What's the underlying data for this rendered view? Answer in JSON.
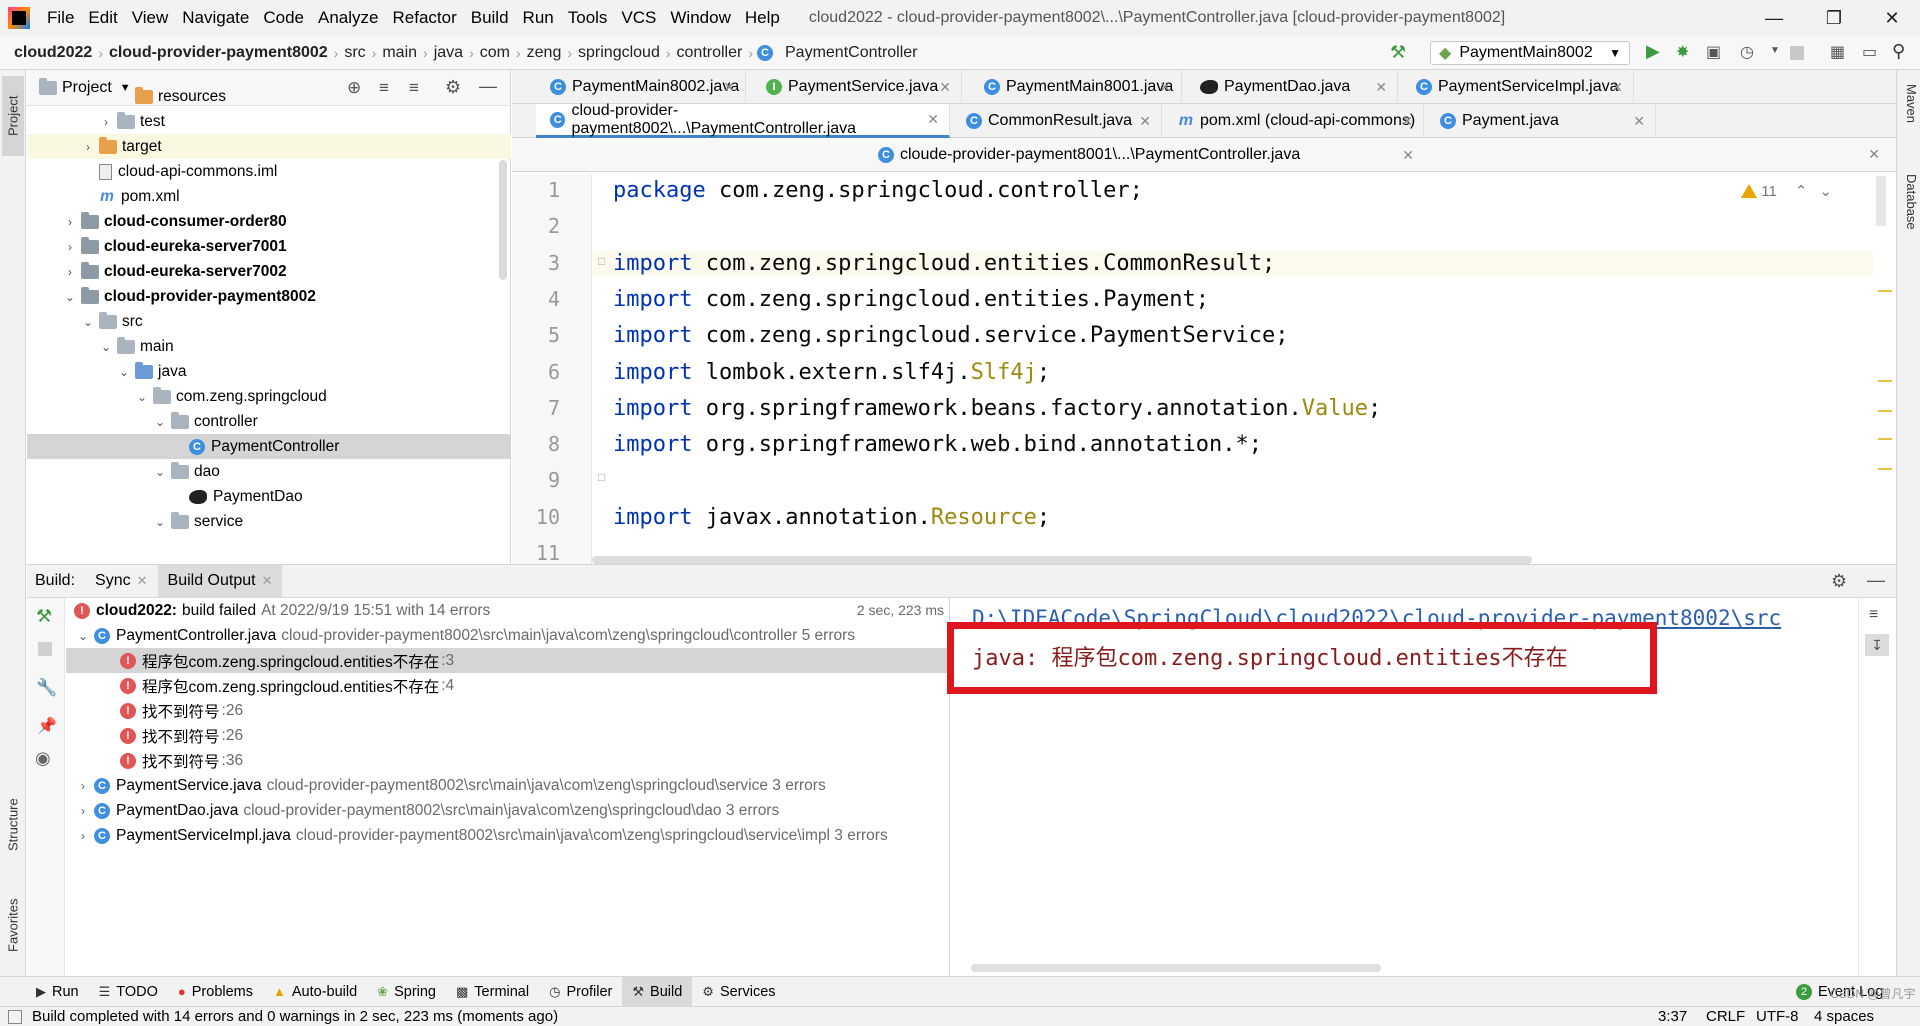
{
  "menu": [
    "File",
    "Edit",
    "View",
    "Navigate",
    "Code",
    "Analyze",
    "Refactor",
    "Build",
    "Run",
    "Tools",
    "VCS",
    "Window",
    "Help"
  ],
  "window_title": "cloud2022 - cloud-provider-payment8002\\...\\PaymentController.java [cloud-provider-payment8002]",
  "breadcrumbs": [
    "cloud2022",
    "cloud-provider-payment8002",
    "src",
    "main",
    "java",
    "com",
    "zeng",
    "springcloud",
    "controller",
    "PaymentController"
  ],
  "run_config": "PaymentMain8002",
  "project_panel": {
    "title": "Project",
    "tree": [
      {
        "label": "resources",
        "indent": 4,
        "icon": "folder-orange",
        "chevron": ""
      },
      {
        "label": "test",
        "indent": 3,
        "icon": "folder",
        "chevron": "›"
      },
      {
        "label": "target",
        "indent": 2,
        "icon": "folder-orange",
        "chevron": "›"
      },
      {
        "label": "cloud-api-commons.iml",
        "indent": 2,
        "icon": "iml",
        "chevron": ""
      },
      {
        "label": "pom.xml",
        "indent": 2,
        "icon": "m",
        "chevron": ""
      },
      {
        "label": "cloud-consumer-order80",
        "indent": 1,
        "icon": "module",
        "chevron": "›",
        "bold": true
      },
      {
        "label": "cloud-eureka-server7001",
        "indent": 1,
        "icon": "module",
        "chevron": "›",
        "bold": true
      },
      {
        "label": "cloud-eureka-server7002",
        "indent": 1,
        "icon": "module",
        "chevron": "›",
        "bold": true
      },
      {
        "label": "cloud-provider-payment8002",
        "indent": 1,
        "icon": "module",
        "chevron": "⌄",
        "bold": true
      },
      {
        "label": "src",
        "indent": 2,
        "icon": "folder",
        "chevron": "⌄"
      },
      {
        "label": "main",
        "indent": 3,
        "icon": "folder",
        "chevron": "⌄"
      },
      {
        "label": "java",
        "indent": 4,
        "icon": "folder-blue",
        "chevron": "⌄"
      },
      {
        "label": "com.zeng.springcloud",
        "indent": 5,
        "icon": "folder",
        "chevron": "⌄"
      },
      {
        "label": "controller",
        "indent": 6,
        "icon": "folder",
        "chevron": "⌄"
      },
      {
        "label": "PaymentController",
        "indent": 7,
        "icon": "class",
        "chevron": "",
        "selected": true
      },
      {
        "label": "dao",
        "indent": 6,
        "icon": "folder",
        "chevron": "⌄"
      },
      {
        "label": "PaymentDao",
        "indent": 7,
        "icon": "bird",
        "chevron": ""
      },
      {
        "label": "service",
        "indent": 6,
        "icon": "folder",
        "chevron": "⌄"
      }
    ]
  },
  "editor_tabs": {
    "row1": [
      {
        "label": "PaymentMain8002.java",
        "icon": "C"
      },
      {
        "label": "PaymentService.java",
        "icon": "I"
      },
      {
        "label": "PaymentMain8001.java",
        "icon": "C"
      },
      {
        "label": "PaymentDao.java",
        "icon": "bird"
      },
      {
        "label": "PaymentServiceImpl.java",
        "icon": "C"
      }
    ],
    "row2": [
      {
        "label": "cloud-provider-payment8002\\...\\PaymentController.java",
        "icon": "C",
        "active": true
      },
      {
        "label": "CommonResult.java",
        "icon": "C"
      },
      {
        "label": "pom.xml (cloud-api-commons)",
        "icon": "m"
      },
      {
        "label": "Payment.java",
        "icon": "C"
      }
    ],
    "row3": [
      {
        "label": "cloude-provider-payment8001\\...\\PaymentController.java",
        "icon": "C"
      }
    ]
  },
  "warnings_count": "11",
  "code_lines": [
    {
      "n": "1",
      "html": "<span class=\"kw\">package</span> com.zeng.springcloud.controller;"
    },
    {
      "n": "2",
      "html": ""
    },
    {
      "n": "3",
      "html": "<span class=\"kw\">import</span> com.zeng.springcloud.entities.CommonResult;"
    },
    {
      "n": "4",
      "html": "<span class=\"kw\">import</span> com.zeng.springcloud.entities.Payment;"
    },
    {
      "n": "5",
      "html": "<span class=\"kw\">import</span> com.zeng.springcloud.service.PaymentService;"
    },
    {
      "n": "6",
      "html": "<span class=\"kw\">import</span> lombok.extern.slf4j.<span class=\"ann\">Slf4j</span>;"
    },
    {
      "n": "7",
      "html": "<span class=\"kw\">import</span> org.springframework.beans.factory.annotation.<span class=\"ann\">Value</span>;"
    },
    {
      "n": "8",
      "html": "<span class=\"kw\">import</span> org.springframework.web.bind.annotation.*;"
    },
    {
      "n": "9",
      "html": ""
    },
    {
      "n": "10",
      "html": "<span class=\"kw\">import</span> javax.annotation.<span class=\"ann\">Resource</span>;"
    },
    {
      "n": "11",
      "html": ""
    }
  ],
  "build": {
    "tabs": {
      "label": "Build:",
      "sync": "Sync",
      "output": "Build Output"
    },
    "summary": {
      "project": "cloud2022:",
      "status": "build failed",
      "when": "At 2022/9/19 15:51 with 14 errors",
      "duration": "2 sec, 223 ms"
    },
    "rows": [
      {
        "file": "PaymentController.java",
        "path": "cloud-provider-payment8002\\src\\main\\java\\com\\zeng\\springcloud\\controller 5 errors",
        "expanded": true
      },
      {
        "msg": "程序包com.zeng.springcloud.entities不存在",
        "line": ":3",
        "selected": true
      },
      {
        "msg": "程序包com.zeng.springcloud.entities不存在",
        "line": ":4"
      },
      {
        "msg": "找不到符号",
        "line": ":26"
      },
      {
        "msg": "找不到符号",
        "line": ":26"
      },
      {
        "msg": "找不到符号",
        "line": ":36"
      },
      {
        "file": "PaymentService.java",
        "path": "cloud-provider-payment8002\\src\\main\\java\\com\\zeng\\springcloud\\service 3 errors"
      },
      {
        "file": "PaymentDao.java",
        "path": "cloud-provider-payment8002\\src\\main\\java\\com\\zeng\\springcloud\\dao 3 errors"
      },
      {
        "file": "PaymentServiceImpl.java",
        "path": "cloud-provider-payment8002\\src\\main\\java\\com\\zeng\\springcloud\\service\\impl 3 errors"
      }
    ],
    "console_path": "D:\\IDEACode\\SpringCloud\\cloud2022\\cloud-provider-payment8002\\src",
    "console_error": "java: 程序包com.zeng.springcloud.entities不存在",
    "highlight_color": "#e0161f"
  },
  "left_stripe": {
    "project": "Project",
    "structure": "Structure",
    "favorites": "Favorites"
  },
  "right_stripe": {
    "maven": "Maven",
    "database": "Database"
  },
  "bottom_tools": [
    {
      "label": "Run",
      "icon": "play"
    },
    {
      "label": "TODO",
      "icon": "list"
    },
    {
      "label": "Problems",
      "icon": "error"
    },
    {
      "label": "Auto-build",
      "icon": "warning"
    },
    {
      "label": "Spring",
      "icon": "leaf"
    },
    {
      "label": "Terminal",
      "icon": "terminal"
    },
    {
      "label": "Profiler",
      "icon": "gauge"
    },
    {
      "label": "Build",
      "icon": "hammer",
      "active": true
    },
    {
      "label": "Services",
      "icon": "services"
    }
  ],
  "event_log": {
    "count": "2",
    "label": "Event Log"
  },
  "status": {
    "message": "Build completed with 14 errors and 0 warnings in 2 sec, 223 ms (moments ago)",
    "position": "3:37",
    "line_sep": "CRLF",
    "encoding": "UTF-8",
    "indent": "4 spaces",
    "watermark": "CSDN @曾凡宇"
  }
}
